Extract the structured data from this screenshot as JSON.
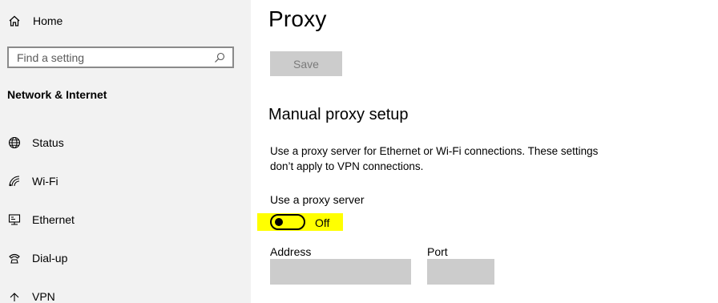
{
  "sidebar": {
    "home_label": "Home",
    "search_placeholder": "Find a setting",
    "section_heading": "Network & Internet",
    "items": [
      {
        "label": "Status",
        "icon": "globe-icon"
      },
      {
        "label": "Wi-Fi",
        "icon": "wifi-icon"
      },
      {
        "label": "Ethernet",
        "icon": "ethernet-icon"
      },
      {
        "label": "Dial-up",
        "icon": "dialup-icon"
      },
      {
        "label": "VPN",
        "icon": "vpn-icon"
      }
    ]
  },
  "main": {
    "title": "Proxy",
    "save_label": "Save",
    "manual_heading": "Manual proxy setup",
    "description": "Use a proxy server for Ethernet or Wi-Fi connections. These settings don’t apply to VPN connections.",
    "toggle_label": "Use a proxy server",
    "toggle_state": "Off",
    "toggle_on": false,
    "address_label": "Address",
    "address_value": "",
    "port_label": "Port",
    "port_value": ""
  },
  "colors": {
    "sidebar_bg": "#f2f2f2",
    "disabled_fill": "#cccccc",
    "highlight": "#ffff00"
  }
}
